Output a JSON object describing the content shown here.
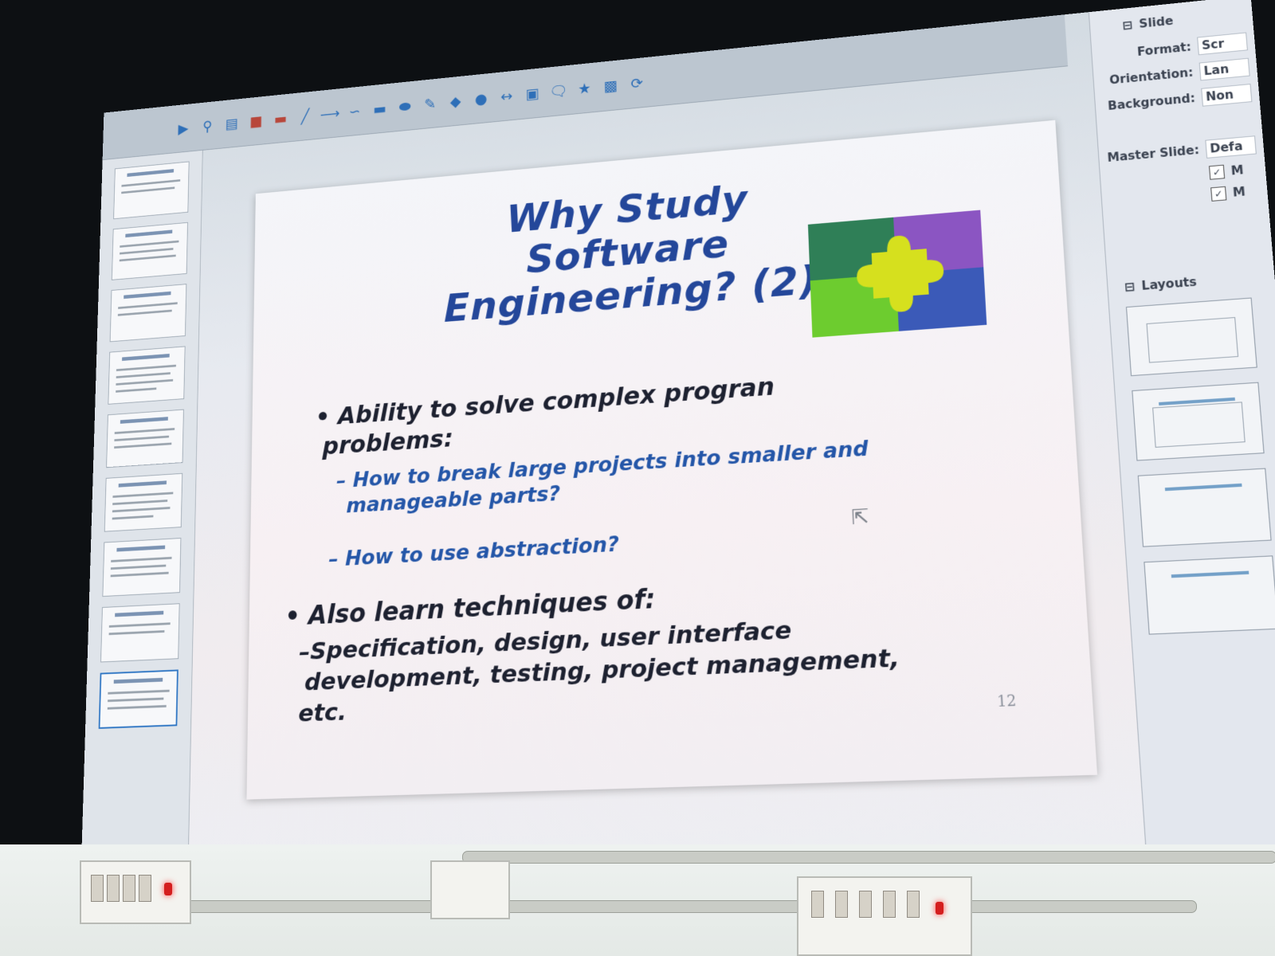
{
  "slide": {
    "title_line1": "Why Study Software",
    "title_line2": "Engineering? (2)",
    "bullet1_line1": "Ability to solve complex progran",
    "bullet1_line2": "problems:",
    "sub1_line1": "How to break large projects into smaller and",
    "sub1_line2": "manageable parts?",
    "sub2": "How to use abstraction?",
    "bullet2": "Also learn techniques of:",
    "sub3_line1": "Specification, design, user interface",
    "sub3_line2": "development, testing, project management,",
    "sub3_line3": "etc.",
    "number": "12",
    "bullet_marker": "•",
    "dash_marker": "–"
  },
  "properties": {
    "section_slide": "Slide",
    "format_label": "Format:",
    "format_value": "Scr",
    "orientation_label": "Orientation:",
    "orientation_value": "Lan",
    "background_label": "Background:",
    "background_value": "Non",
    "master_label": "Master Slide:",
    "master_value": "Defa",
    "check1_text": "M",
    "check2_text": "M",
    "layouts_label": "Layouts"
  },
  "colors": {
    "title": "#24479a",
    "body": "#1d2130",
    "sub_bullet": "#2456a8",
    "puzzle_green_dark": "#2f7f57",
    "puzzle_purple": "#8b55c2",
    "puzzle_yellow": "#d6e01e",
    "puzzle_green_light": "#6dcc2f",
    "puzzle_blue": "#3b5ab8"
  }
}
